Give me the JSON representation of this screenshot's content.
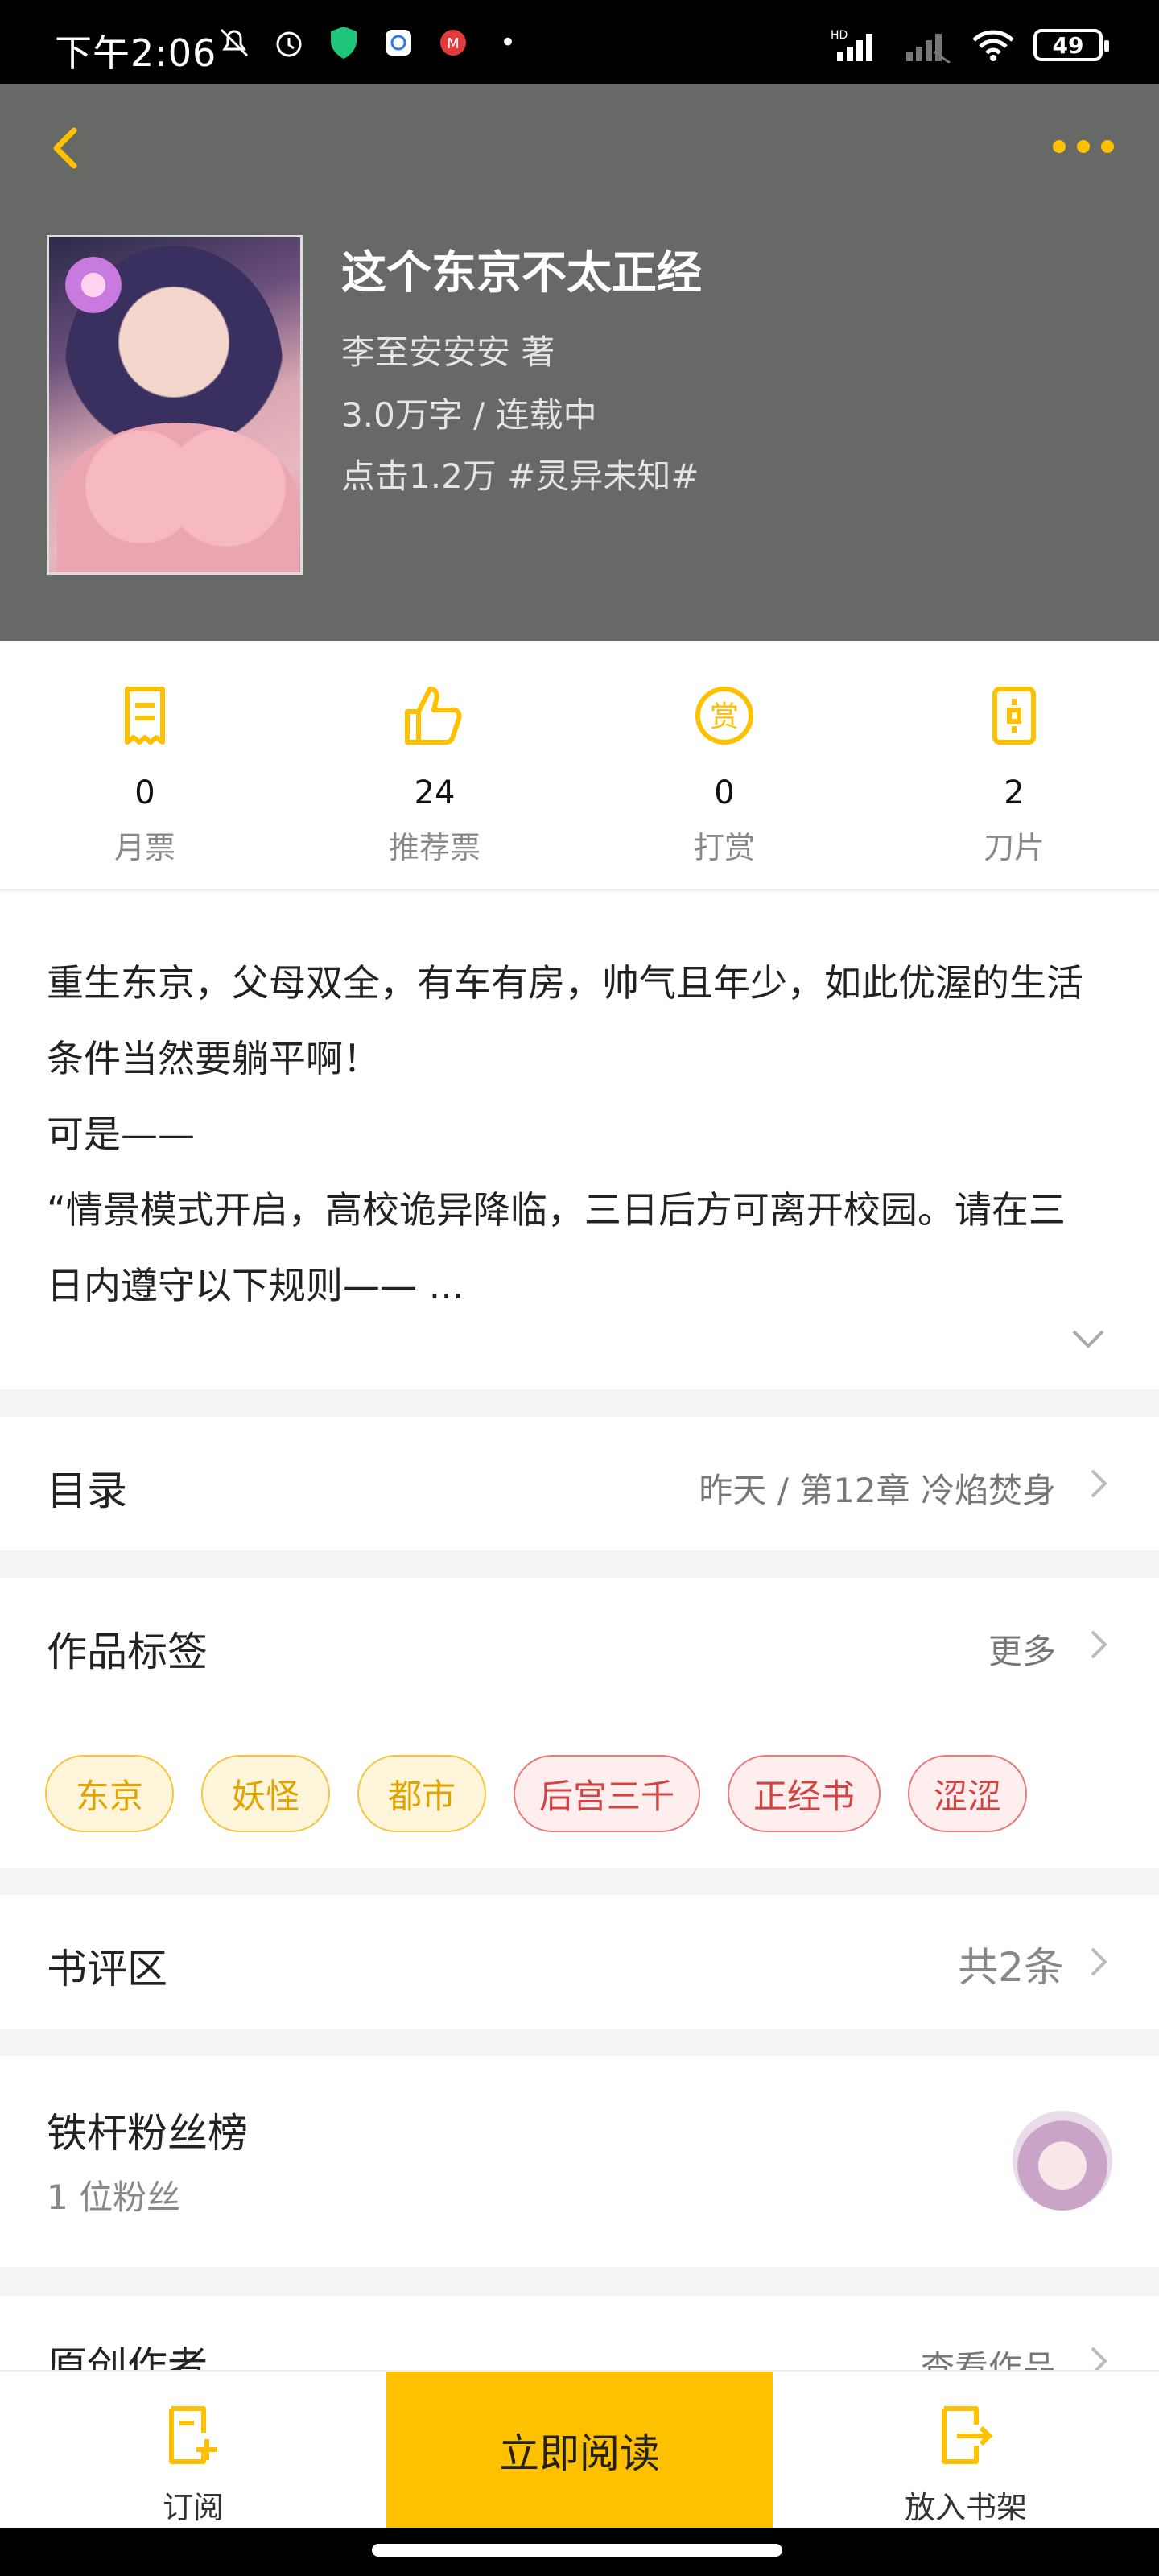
{
  "status_bar": {
    "time": "下午2:06",
    "battery": "49",
    "network": "HD"
  },
  "book": {
    "title": "这个东京不太正经",
    "author_line": "李至安安安  著",
    "words_status": "3.0万字 / 连载中",
    "clicks_genre": "点击1.2万  #灵异未知#"
  },
  "stats": [
    {
      "value": "0",
      "label": "月票",
      "icon": "monthly-ticket-icon"
    },
    {
      "value": "24",
      "label": "推荐票",
      "icon": "thumbs-up-icon"
    },
    {
      "value": "0",
      "label": "打赏",
      "icon": "reward-icon"
    },
    {
      "value": "2",
      "label": "刀片",
      "icon": "blade-icon"
    }
  ],
  "synopsis": {
    "lines": [
      "重生东京，父母双全，有车有房，帅气且年少，如此优渥的生活",
      "条件当然要躺平啊！",
      "可是——",
      "“情景模式开启，高校诡异降临，三日后方可离开校园。请在三",
      "日内遵守以下规则—— ..."
    ]
  },
  "catalog": {
    "label": "目录",
    "latest": "昨天 / 第12章  冷焰焚身"
  },
  "tags_section": {
    "label": "作品标签",
    "more": "更多",
    "tags": [
      {
        "text": "东京",
        "style": "yellow"
      },
      {
        "text": "妖怪",
        "style": "yellow"
      },
      {
        "text": "都市",
        "style": "yellow"
      },
      {
        "text": "后宫三千",
        "style": "red"
      },
      {
        "text": "正经书",
        "style": "red"
      },
      {
        "text": "涩涩",
        "style": "red"
      }
    ]
  },
  "reviews": {
    "label": "书评区",
    "count": "共2条"
  },
  "fans": {
    "label": "铁杆粉丝榜",
    "count": "1 位粉丝"
  },
  "author_section": {
    "label": "原创作者",
    "link": "查看作品"
  },
  "bottom_bar": {
    "subscribe": "订阅",
    "read_now": "立即阅读",
    "add_shelf": "放入书架"
  },
  "colors": {
    "accent": "#ffc000",
    "header_bg": "#676966",
    "tag_yellow": "#e2a200",
    "tag_red": "#d24444"
  }
}
